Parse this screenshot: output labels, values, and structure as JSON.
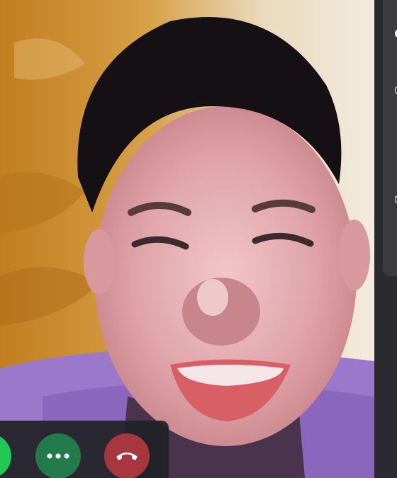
{
  "call": {
    "video_description_icon": "remote-participant-video",
    "controls": [
      {
        "name": "accept-call-button",
        "icon": "phone-icon",
        "color": "#1fc954"
      },
      {
        "name": "more-options-button",
        "icon": "more-horizontal-icon",
        "color": "#237a4d"
      },
      {
        "name": "end-call-button",
        "icon": "hang-up-icon",
        "color": "#a8363f"
      }
    ]
  },
  "side_panel": {
    "icons": [
      "panel-icon-1",
      "panel-icon-2",
      "panel-icon-3",
      "panel-icon-4"
    ]
  },
  "colors": {
    "accept": "#1fc954",
    "more": "#237a4d",
    "hangup": "#a8363f",
    "bar_bg": "#202226",
    "panel_bg": "#2a2b30"
  }
}
